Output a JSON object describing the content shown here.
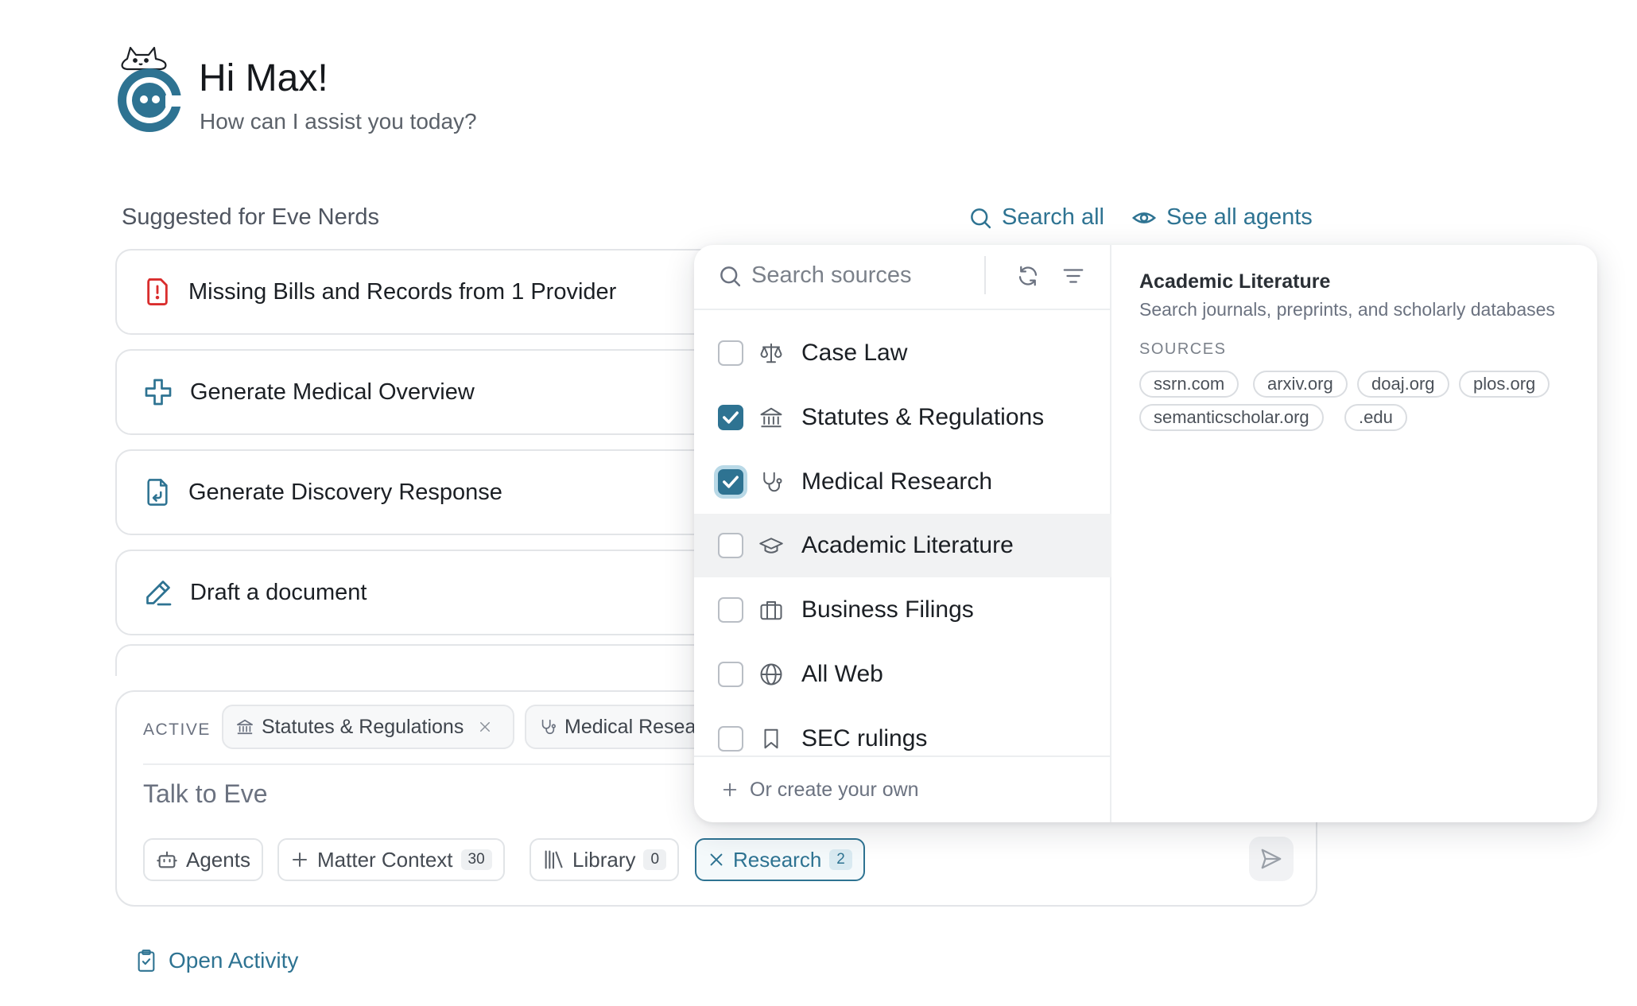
{
  "greeting": {
    "title": "Hi Max!",
    "subtitle": "How can I assist you today?"
  },
  "suggested": {
    "label": "Suggested for Eve Nerds",
    "search_all": "Search all",
    "see_all_agents": "See all agents",
    "cards": [
      {
        "label": "Missing Bills and Records from 1 Provider",
        "icon": "alert-document-icon"
      },
      {
        "label": "Generate Medical Overview",
        "icon": "medical-cross-icon"
      },
      {
        "label": "Generate Discovery Response",
        "icon": "document-return-icon"
      },
      {
        "label": "Draft a document",
        "icon": "pencil-icon"
      }
    ]
  },
  "composer": {
    "active_label": "ACTIVE",
    "active_chips": [
      {
        "label": "Statutes & Regulations",
        "icon": "building-columns-icon"
      },
      {
        "label": "Medical Resea",
        "icon": "stethoscope-icon"
      }
    ],
    "placeholder": "Talk to Eve",
    "tools": {
      "agents": "Agents",
      "matter_context": "Matter Context",
      "matter_context_count": "30",
      "library": "Library",
      "library_count": "0",
      "research": "Research",
      "research_count": "2"
    }
  },
  "open_activity": "Open Activity",
  "sources_panel": {
    "search_placeholder": "Search sources",
    "items": [
      {
        "label": "Case Law",
        "checked": false,
        "icon": "scales-icon"
      },
      {
        "label": "Statutes & Regulations",
        "checked": true,
        "icon": "building-columns-icon"
      },
      {
        "label": "Medical Research",
        "checked": true,
        "icon": "stethoscope-icon"
      },
      {
        "label": "Academic Literature",
        "checked": false,
        "icon": "graduation-cap-icon"
      },
      {
        "label": "Business Filings",
        "checked": false,
        "icon": "briefcase-icon"
      },
      {
        "label": "All Web",
        "checked": false,
        "icon": "globe-icon"
      },
      {
        "label": "SEC rulings",
        "checked": false,
        "icon": "bookmark-icon"
      }
    ],
    "create_own": "Or create your own",
    "detail": {
      "title": "Academic Literature",
      "description": "Search journals, preprints, and scholarly databases",
      "sources_label": "SOURCES",
      "sources": [
        "ssrn.com",
        "arxiv.org",
        "doaj.org",
        "plos.org",
        "semanticscholar.org",
        ".edu"
      ]
    }
  },
  "colors": {
    "accent": "#2e7392",
    "alert": "#d92d2d",
    "border": "#e3e5e8",
    "hover_row": "#f1f2f3"
  }
}
